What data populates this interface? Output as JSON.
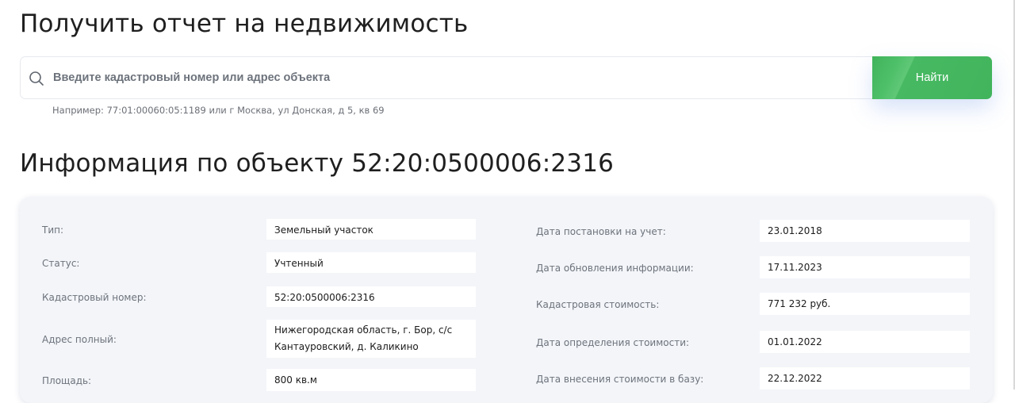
{
  "page": {
    "title": "Получить отчет на недвижимость"
  },
  "search": {
    "placeholder": "Введите кадастровый номер или адрес объекта",
    "value": "",
    "button_label": "Найти",
    "hint": "Например: 77:01:00060:05:1189 или г Москва, ул Донская, д 5, кв 69"
  },
  "object": {
    "heading": "Информация по объекту 52:20:0500006:2316",
    "left": [
      {
        "label": "Тип:",
        "value": "Земельный участок"
      },
      {
        "label": "Статус:",
        "value": "Учтенный"
      },
      {
        "label": "Кадастровый номер:",
        "value": "52:20:0500006:2316"
      },
      {
        "label": "Адрес полный:",
        "value": "Нижегородская область, г. Бор, с/с Кантауровский, д. Каликино"
      },
      {
        "label": "Площадь:",
        "value": "800 кв.м"
      }
    ],
    "right": [
      {
        "label": "Дата постановки на учет:",
        "value": "23.01.2018"
      },
      {
        "label": "Дата обновления информации:",
        "value": "17.11.2023"
      },
      {
        "label": "Кадастровая стоимость:",
        "value": "771 232 руб."
      },
      {
        "label": "Дата определения стоимости:",
        "value": "01.01.2022"
      },
      {
        "label": "Дата внесения стоимости в базу:",
        "value": "22.12.2022"
      }
    ]
  },
  "colors": {
    "accent_green": "#42b45c",
    "label_gray": "#6d737c",
    "card_bg": "#f3f5f9"
  },
  "icons": {
    "search": "search-icon"
  }
}
